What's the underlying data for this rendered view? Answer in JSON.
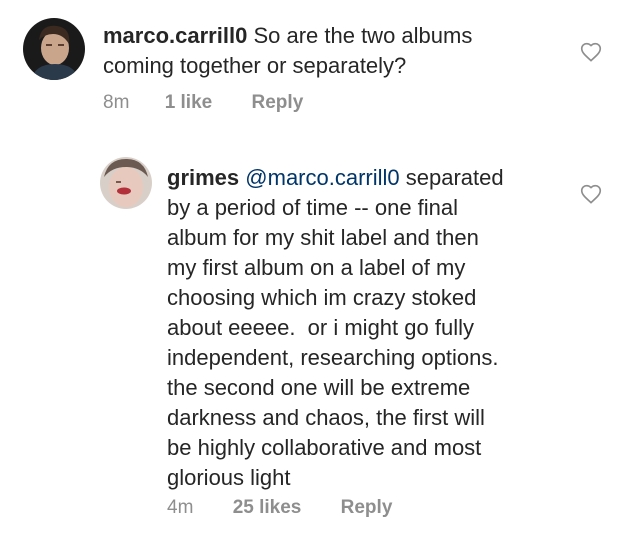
{
  "comments": [
    {
      "username": "marco.carrill0",
      "text": "So are the two albums coming together or separately?",
      "time": "8m",
      "likes": "1 like",
      "reply_label": "Reply",
      "like_icon": "heart-outline-icon"
    },
    {
      "username": "grimes",
      "mention": "@marco.carrill0",
      "text_lines": [
        "separated",
        "by a period of time -- one final",
        "album for my shit label and then",
        "my first album on a label of my",
        "choosing which im crazy stoked",
        "about eeeee.  or i might go fully",
        "independent, researching options.",
        "the second one will be extreme",
        "darkness and chaos, the first will",
        "be highly collaborative and most",
        "glorious light"
      ],
      "time": "4m",
      "likes": "25 likes",
      "reply_label": "Reply",
      "like_icon": "heart-outline-icon"
    }
  ],
  "colors": {
    "text": "#262626",
    "mention": "#003569",
    "meta": "#8e8e8e"
  }
}
